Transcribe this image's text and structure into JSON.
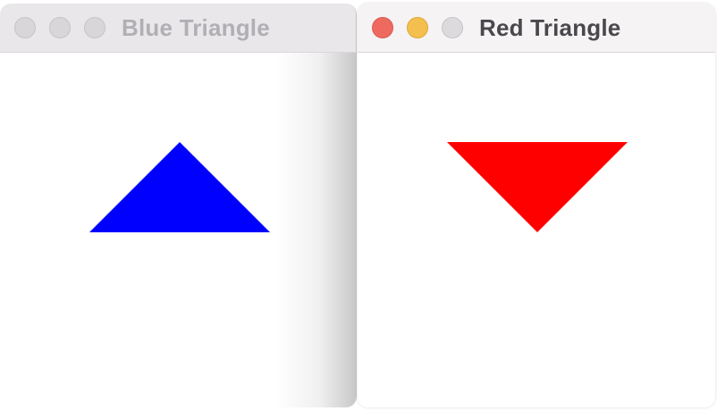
{
  "windows": [
    {
      "title": "Blue Triangle",
      "active": false,
      "shape": {
        "kind": "triangle",
        "direction": "up",
        "color": "#0000ff"
      }
    },
    {
      "title": "Red Triangle",
      "active": true,
      "shape": {
        "kind": "triangle",
        "direction": "down",
        "color": "#ff0000"
      }
    }
  ]
}
